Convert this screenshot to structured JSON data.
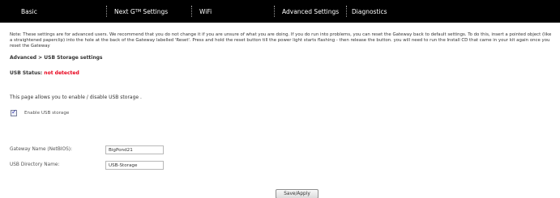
{
  "nav": {
    "basic": "Basic",
    "next_g_prefix": "Next G",
    "next_g_sup": "TM",
    "next_g_suffix": " Settings",
    "wifi": "WiFi",
    "advanced": "Advanced Settings",
    "diagnostics": "Diagnostics"
  },
  "note": "Note: These settings are for advanced users. We recommend that you do not change it if you are unsure of what you are doing. If you do run into problems, you can reset the Gateway back to default settings. To do this, insert a pointed object (like a straightened paperclip) into the hole at the back of the Gateway labelled 'Reset'. Press and hold the reset button till the power light starts flashing - then release the button. you will need to run the Install CD that came in your kit again once you reset the Gateway",
  "breadcrumb": "Advanced > USB Storage settings",
  "status": {
    "label": "USB Status: ",
    "value": "not detected",
    "value_color": "#e8001a"
  },
  "description": "This page allows you to enable / disable USB storage .",
  "enable_usb": {
    "checked": true,
    "label": "Enable USB storage"
  },
  "fields": {
    "gateway_name_label": "Gateway Name (NetBIOS):",
    "gateway_name_value": "BigPond21",
    "usb_dir_label": "USB Directory Name:",
    "usb_dir_value": "USB-Storage"
  },
  "save_button": "Save/Apply"
}
